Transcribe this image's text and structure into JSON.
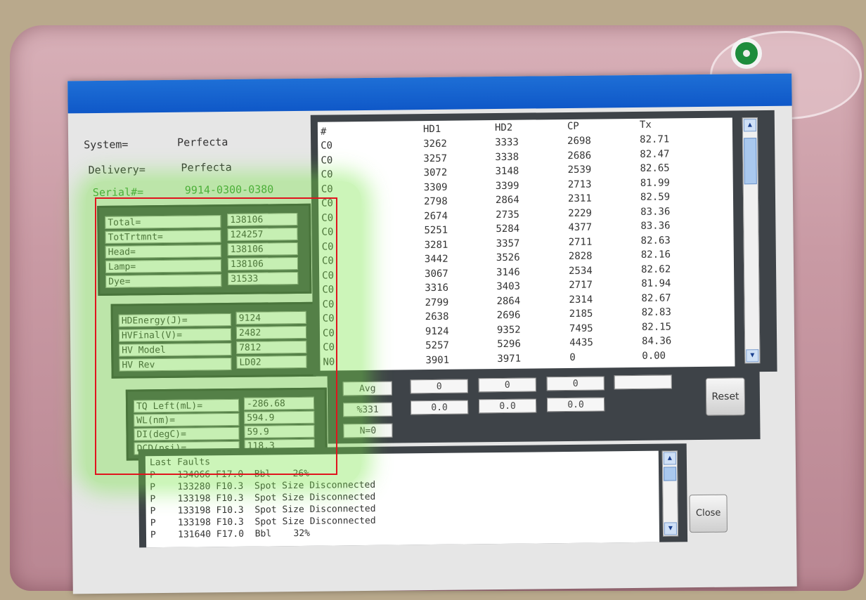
{
  "system": {
    "label": "System=",
    "value": "Perfecta"
  },
  "delivery": {
    "label": "Delivery=",
    "value": "Perfecta"
  },
  "serial": {
    "label": "Serial#=",
    "value": "9914-0300-0380"
  },
  "counters": [
    {
      "label": "Total=",
      "value": "138106"
    },
    {
      "label": "TotTrtmnt=",
      "value": "124257"
    },
    {
      "label": "Head=",
      "value": "138106"
    },
    {
      "label": "Lamp=",
      "value": "138106"
    },
    {
      "label": "Dye=",
      "value": "31533"
    }
  ],
  "hv": [
    {
      "label": "HDEnergy(J)=",
      "value": "9124"
    },
    {
      "label": "HVFinal(V)=",
      "value": "2482"
    },
    {
      "label": "HV Model",
      "value": "7812"
    },
    {
      "label": "HV Rev",
      "value": "LD02"
    }
  ],
  "misc": [
    {
      "label": "TQ Left(mL)=",
      "value": "-286.68"
    },
    {
      "label": "WL(nm)=",
      "value": "594.9"
    },
    {
      "label": "DI(degC)=",
      "value": "59.9"
    },
    {
      "label": "DCD(psi)=",
      "value": "118.3"
    }
  ],
  "table": {
    "headers": [
      "#",
      "HD1",
      "HD2",
      "CP",
      "Tx"
    ],
    "rows": [
      [
        "C0",
        "3262",
        "3333",
        "2698",
        "82.71"
      ],
      [
        "C0",
        "3257",
        "3338",
        "2686",
        "82.47"
      ],
      [
        "C0",
        "3072",
        "3148",
        "2539",
        "82.65"
      ],
      [
        "C0",
        "3309",
        "3399",
        "2713",
        "81.99"
      ],
      [
        "C0",
        "2798",
        "2864",
        "2311",
        "82.59"
      ],
      [
        "C0",
        "2674",
        "2735",
        "2229",
        "83.36"
      ],
      [
        "C0",
        "5251",
        "5284",
        "4377",
        "83.36"
      ],
      [
        "C0",
        "3281",
        "3357",
        "2711",
        "82.63"
      ],
      [
        "C0",
        "3442",
        "3526",
        "2828",
        "82.16"
      ],
      [
        "C0",
        "3067",
        "3146",
        "2534",
        "82.62"
      ],
      [
        "C0",
        "3316",
        "3403",
        "2717",
        "81.94"
      ],
      [
        "C0",
        "2799",
        "2864",
        "2314",
        "82.67"
      ],
      [
        "C0",
        "2638",
        "2696",
        "2185",
        "82.83"
      ],
      [
        "C0",
        "9124",
        "9352",
        "7495",
        "82.15"
      ],
      [
        "C0",
        "5257",
        "5296",
        "4435",
        "84.36"
      ],
      [
        "N0",
        "3901",
        "3971",
        "0",
        "0.00"
      ]
    ]
  },
  "stats": {
    "avg_label": "Avg",
    "avg_values": [
      "0",
      "0",
      "0",
      ""
    ],
    "pct_label": "%331",
    "pct_values": [
      "0.0",
      "0.0",
      "0.0"
    ],
    "n_label": "N=0",
    "reset_label": "Reset"
  },
  "faults": {
    "title": "Last Faults",
    "rows": [
      "P    134066 F17.0  Bbl    26%",
      "P    133280 F10.3  Spot Size Disconnected",
      "P    133198 F10.3  Spot Size Disconnected",
      "P    133198 F10.3  Spot Size Disconnected",
      "P    133198 F10.3  Spot Size Disconnected",
      "P    131640 F17.0  Bbl    32%"
    ],
    "close_label": "Close"
  }
}
